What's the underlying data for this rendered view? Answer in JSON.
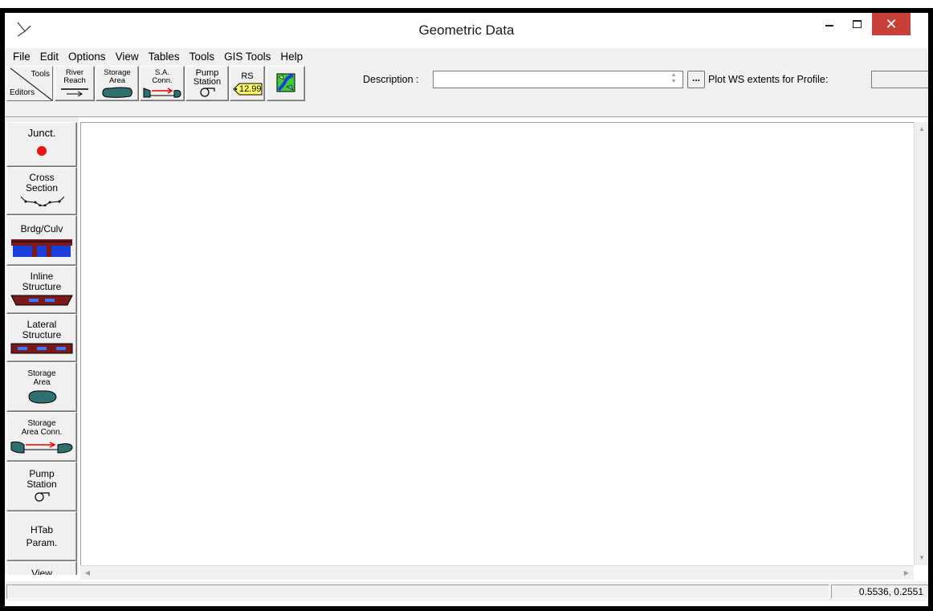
{
  "window": {
    "title": "Geometric Data",
    "close_glyph": "✕"
  },
  "menu": [
    "File",
    "Edit",
    "Options",
    "View",
    "Tables",
    "Tools",
    "GIS Tools",
    "Help"
  ],
  "toolbar": {
    "tools_label": "Tools",
    "editors_label": "Editors",
    "river_reach": [
      "River",
      "Reach"
    ],
    "storage_area": [
      "Storage",
      "Area"
    ],
    "sa_conn": [
      "S.A.",
      "Conn."
    ],
    "pump_station": [
      "Pump",
      "Station"
    ],
    "rs_label": "RS",
    "rs_value": "12.99",
    "description_label": "Description :",
    "description_value": "",
    "ellipsis_label": "...",
    "plot_ws_label": "Plot WS extents for Profile:",
    "plot_ws_value": ""
  },
  "editors": {
    "junct": "Junct.",
    "cross_section": [
      "Cross",
      "Section"
    ],
    "brdg_culv": "Brdg/Culv",
    "inline_structure": [
      "Inline",
      "Structure"
    ],
    "lateral_structure": [
      "Lateral",
      "Structure"
    ],
    "storage_area": [
      "Storage",
      "Area"
    ],
    "storage_area_conn": [
      "Storage",
      "Area Conn."
    ],
    "pump_station": [
      "Pump",
      "Station"
    ],
    "htab_param": [
      "HTab",
      "Param."
    ],
    "view": "View"
  },
  "status": {
    "coords": "0.5536, 0.2551"
  },
  "colors": {
    "close_button": "#c7413a",
    "storage_fill": "#2f6f6f",
    "structure_red": "#7a1a1a",
    "water_blue": "#1a3fd8",
    "rs_yellow": "#ffff66",
    "junction_red": "#ee1111"
  },
  "icons": {
    "app": "hec-ras-icon",
    "map": "gis-map-icon"
  }
}
